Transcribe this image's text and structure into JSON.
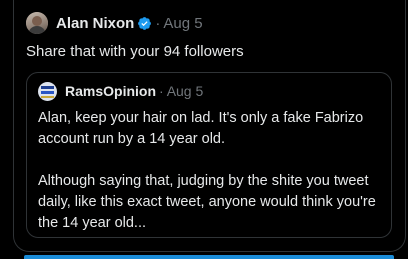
{
  "post": {
    "author": "Alan Nixon",
    "separator": "·",
    "date": "Aug 5",
    "text": "Share that with your 94 followers",
    "verified": true
  },
  "quoted": {
    "author": "RamsOpinion",
    "separator": "·",
    "date": "Aug 5",
    "paragraphs": [
      "Alan, keep your hair on lad. It's only a fake Fabrizo account run by a 14 year old.",
      "Although saying that, judging by the shite you tweet daily, like this exact tweet, anyone would think you're the 14 year old..."
    ]
  },
  "colors": {
    "background": "#000000",
    "border": "#2f3336",
    "text": "#e7e9ea",
    "muted": "#71767b",
    "accent": "#1d9bf0"
  }
}
